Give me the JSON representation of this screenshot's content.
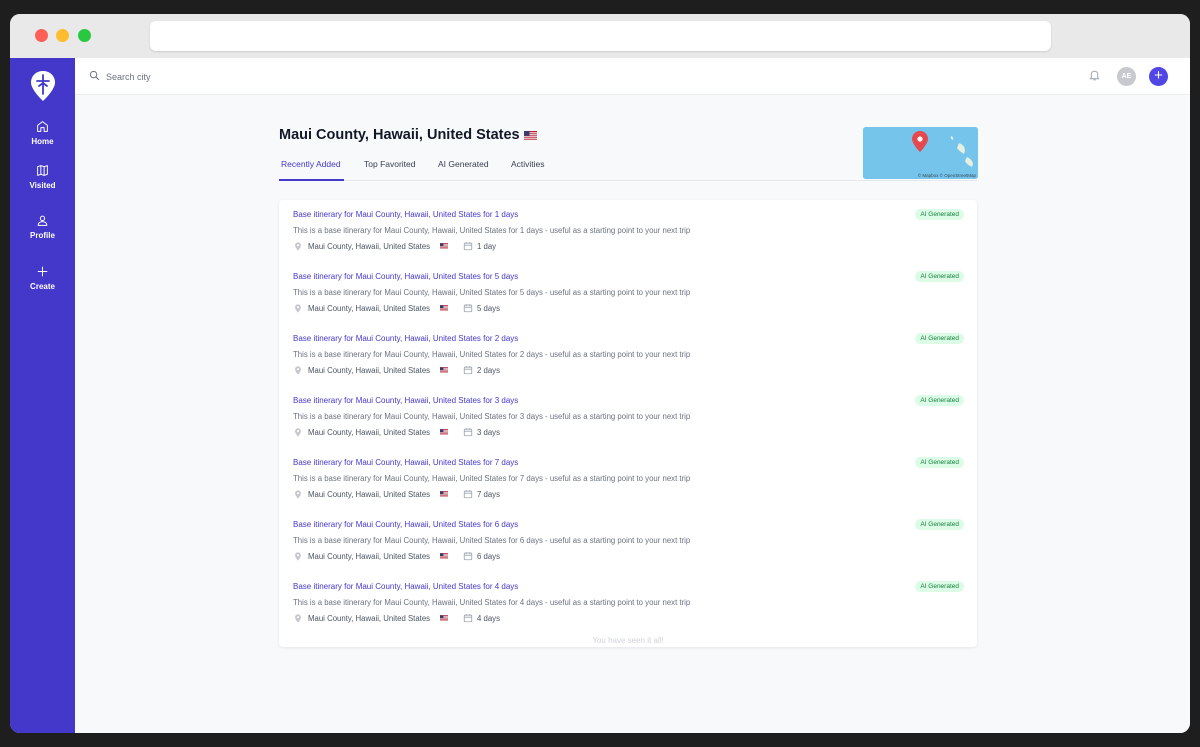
{
  "search": {
    "placeholder": "Search city"
  },
  "user": {
    "initials": "AE"
  },
  "sidebar": {
    "items": [
      {
        "label": "Home",
        "icon": "home-icon"
      },
      {
        "label": "Visited",
        "icon": "map-icon"
      },
      {
        "label": "Profile",
        "icon": "user-icon"
      },
      {
        "label": "Create",
        "icon": "plus-icon"
      }
    ]
  },
  "page": {
    "title": "Maui County, Hawaii, United States",
    "flag": "us-flag",
    "map_credit": "© Mapbox © OpenStreetMap",
    "tabs": [
      {
        "label": "Recently Added",
        "active": true
      },
      {
        "label": "Top Favorited",
        "active": false
      },
      {
        "label": "AI Generated",
        "active": false
      },
      {
        "label": "Activities",
        "active": false
      }
    ]
  },
  "itineraries": [
    {
      "title": "Base itinerary for Maui County, Hawaii, United States for 1 days",
      "description": "This is a base itinerary for Maui County, Hawaii, United States for 1 days - useful as a starting point to your next trip",
      "location": "Maui County, Hawaii, United States",
      "duration": "1 day",
      "badge": "AI Generated"
    },
    {
      "title": "Base itinerary for Maui County, Hawaii, United States for 5 days",
      "description": "This is a base itinerary for Maui County, Hawaii, United States for 5 days - useful as a starting point to your next trip",
      "location": "Maui County, Hawaii, United States",
      "duration": "5 days",
      "badge": "AI Generated"
    },
    {
      "title": "Base itinerary for Maui County, Hawaii, United States for 2 days",
      "description": "This is a base itinerary for Maui County, Hawaii, United States for 2 days - useful as a starting point to your next trip",
      "location": "Maui County, Hawaii, United States",
      "duration": "2 days",
      "badge": "AI Generated"
    },
    {
      "title": "Base itinerary for Maui County, Hawaii, United States for 3 days",
      "description": "This is a base itinerary for Maui County, Hawaii, United States for 3 days - useful as a starting point to your next trip",
      "location": "Maui County, Hawaii, United States",
      "duration": "3 days",
      "badge": "AI Generated"
    },
    {
      "title": "Base itinerary for Maui County, Hawaii, United States for 7 days",
      "description": "This is a base itinerary for Maui County, Hawaii, United States for 7 days - useful as a starting point to your next trip",
      "location": "Maui County, Hawaii, United States",
      "duration": "7 days",
      "badge": "AI Generated"
    },
    {
      "title": "Base itinerary for Maui County, Hawaii, United States for 6 days",
      "description": "This is a base itinerary for Maui County, Hawaii, United States for 6 days - useful as a starting point to your next trip",
      "location": "Maui County, Hawaii, United States",
      "duration": "6 days",
      "badge": "AI Generated"
    },
    {
      "title": "Base itinerary for Maui County, Hawaii, United States for 4 days",
      "description": "This is a base itinerary for Maui County, Hawaii, United States for 4 days - useful as a starting point to your next trip",
      "location": "Maui County, Hawaii, United States",
      "duration": "4 days",
      "badge": "AI Generated"
    }
  ],
  "end_message": "You have seen it all!",
  "colors": {
    "sidebar": "#4338ca",
    "accent": "#4f46e5",
    "badge_bg": "#dcfce7",
    "badge_text": "#15803d",
    "map_pin": "#e5484d"
  }
}
